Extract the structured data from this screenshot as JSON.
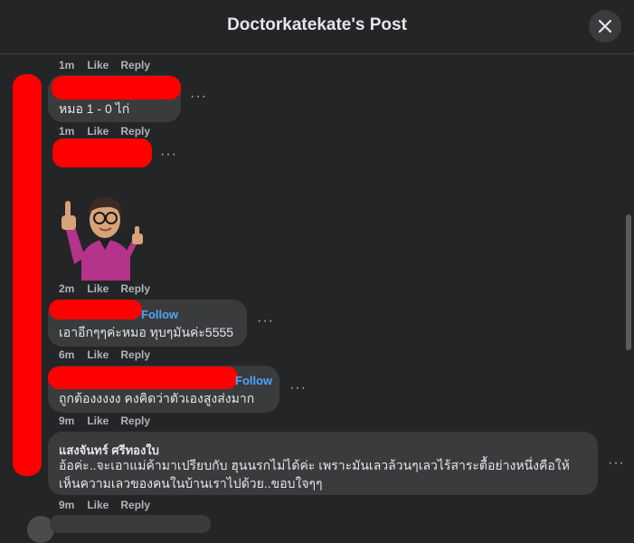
{
  "header": {
    "title": "Doctorkatekate's Post"
  },
  "labels": {
    "like": "Like",
    "reply": "Reply",
    "follow": "Follow",
    "more": "···"
  },
  "comments": [
    {
      "time": "1m"
    },
    {
      "text": "หมอ 1 - 0 ไก่",
      "time": "1m"
    },
    {
      "time": "2m",
      "sticker": "thumbs-up-avatar-sticker"
    },
    {
      "text": "เอาอีกๆๆค่ะหมอ ทุบๆมันค่ะ5555",
      "time": "6m"
    },
    {
      "text": "ถูกต้องงงงง คงคิดว่าตัวเองสูงส่งมาก",
      "time": "9m"
    },
    {
      "name": "แสงจันทร์ ศรีทองใบ",
      "text_line1": "อ้อค่ะ..จะเอาแม่ค้ามาเปรียบกับ ฮุนนรกไม่ได้ค่ะ เพราะมันเลวล้วนๆเลวไร้สาระตื้อย่างหนึ่งคือให้",
      "text_line2": "เห็นความเลวของคนในบ้านเราไปด้วย..ขอบใจๆๆ",
      "time": "9m"
    }
  ],
  "colors": {
    "redaction": "#ff0000",
    "link": "#4da3ff",
    "background": "#242526",
    "bubble": "#3a3b3c"
  }
}
